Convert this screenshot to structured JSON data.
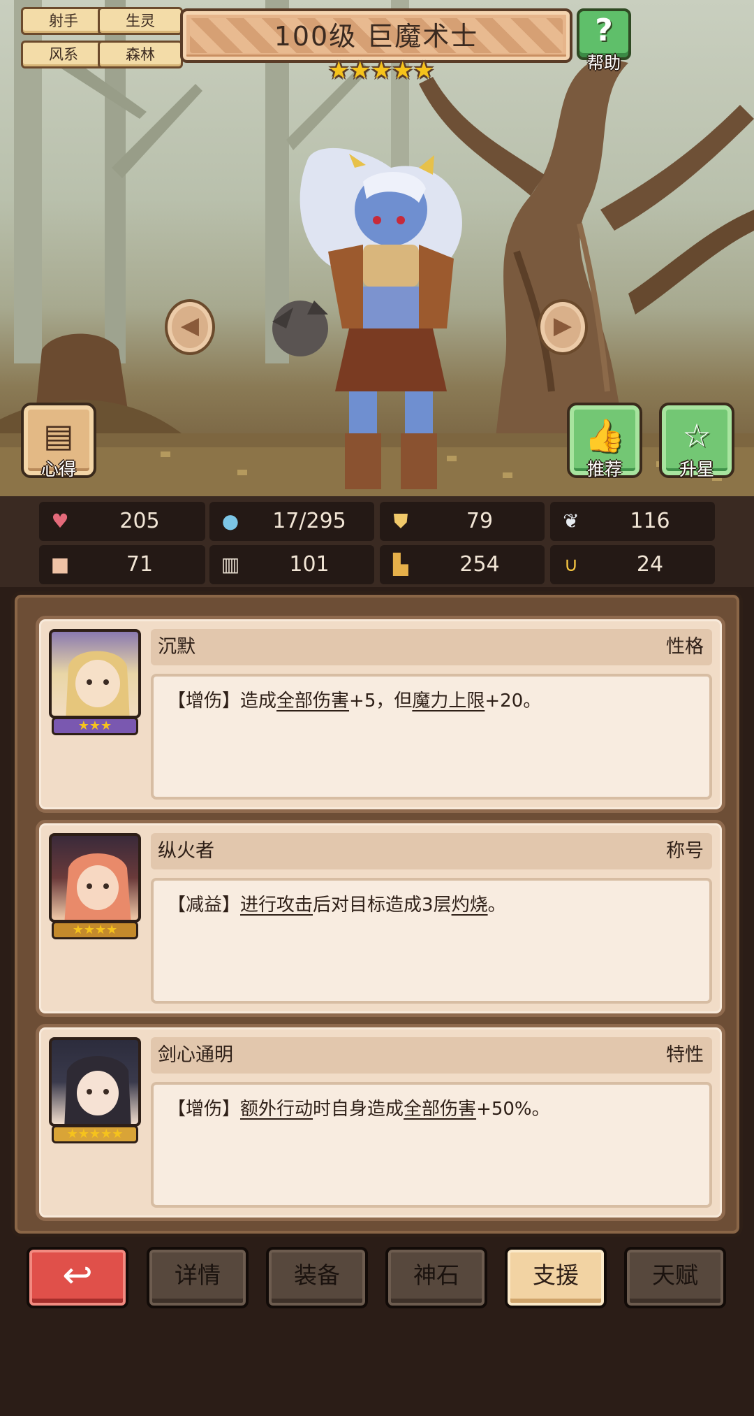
{
  "tags": [
    "射手",
    "生灵",
    "风系",
    "森林"
  ],
  "hero": {
    "title": "100级 巨魔术士",
    "stars": "★★★★★"
  },
  "buttons": {
    "help": "帮助",
    "notes": "心得",
    "recommend": "推荐",
    "upstar": "升星"
  },
  "stats": [
    {
      "icon": "heart-icon",
      "glyph": "♥",
      "color": "#e46a7a",
      "value": "205"
    },
    {
      "icon": "mana-drop-icon",
      "glyph": "💧",
      "color": "#7cc6e6",
      "value": "17/295"
    },
    {
      "icon": "shield-icon",
      "glyph": "⛊",
      "color": "#f1c96a",
      "value": "79"
    },
    {
      "icon": "wing-icon",
      "glyph": "❦",
      "color": "#e8ecf0",
      "value": "116"
    },
    {
      "icon": "fist-icon",
      "glyph": "✊",
      "color": "#f0c3a6",
      "value": "71"
    },
    {
      "icon": "book-icon",
      "glyph": "📖",
      "color": "#e8ded0",
      "value": "101"
    },
    {
      "icon": "boot-icon",
      "glyph": "▙",
      "color": "#e6b04a",
      "value": "254"
    },
    {
      "icon": "horseshoe-icon",
      "glyph": "∪",
      "color": "#f4c542",
      "value": "24"
    }
  ],
  "support": [
    {
      "name": "沉默",
      "type": "性格",
      "stars": "★★★",
      "segments": [
        "【增伤】造成",
        "全部伤害",
        "+5，但",
        "魔力上限",
        "+20。"
      ]
    },
    {
      "name": "纵火者",
      "type": "称号",
      "stars": "★★★★",
      "segments": [
        "【减益】",
        "进行攻击",
        "后对目标造成3层",
        "灼烧",
        "。"
      ]
    },
    {
      "name": "剑心通明",
      "type": "特性",
      "stars": "★★★★★",
      "segments": [
        "【增伤】",
        "额外行动",
        "时自身造成",
        "全部伤害",
        "+50%。"
      ]
    }
  ],
  "nav": {
    "back_glyph": "↩",
    "details": "详情",
    "equip": "装备",
    "godstone": "神石",
    "support": "支援",
    "talent": "天赋"
  }
}
